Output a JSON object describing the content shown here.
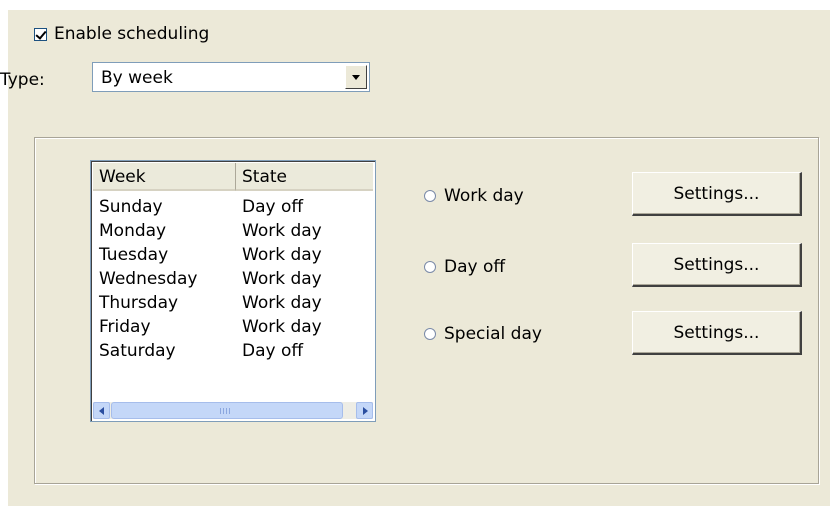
{
  "enable_scheduling": {
    "label": "Enable scheduling",
    "checked": true
  },
  "type": {
    "label": "Type:",
    "value": "By week"
  },
  "list": {
    "columns": [
      "Week",
      "State"
    ],
    "rows": [
      {
        "week": "Sunday",
        "state": "Day off"
      },
      {
        "week": "Monday",
        "state": "Work day"
      },
      {
        "week": "Tuesday",
        "state": "Work day"
      },
      {
        "week": "Wednesday",
        "state": "Work day"
      },
      {
        "week": "Thursday",
        "state": "Work day"
      },
      {
        "week": "Friday",
        "state": "Work day"
      },
      {
        "week": "Saturday",
        "state": "Day off"
      }
    ]
  },
  "options": [
    {
      "label": "Work day",
      "button": "Settings..."
    },
    {
      "label": "Day off",
      "button": "Settings..."
    },
    {
      "label": "Special day",
      "button": "Settings..."
    }
  ],
  "icons": {
    "checkbox": "check-icon",
    "dropdown": "chevron-down-icon",
    "scroll_left": "arrow-left-icon",
    "scroll_right": "arrow-right-icon"
  }
}
